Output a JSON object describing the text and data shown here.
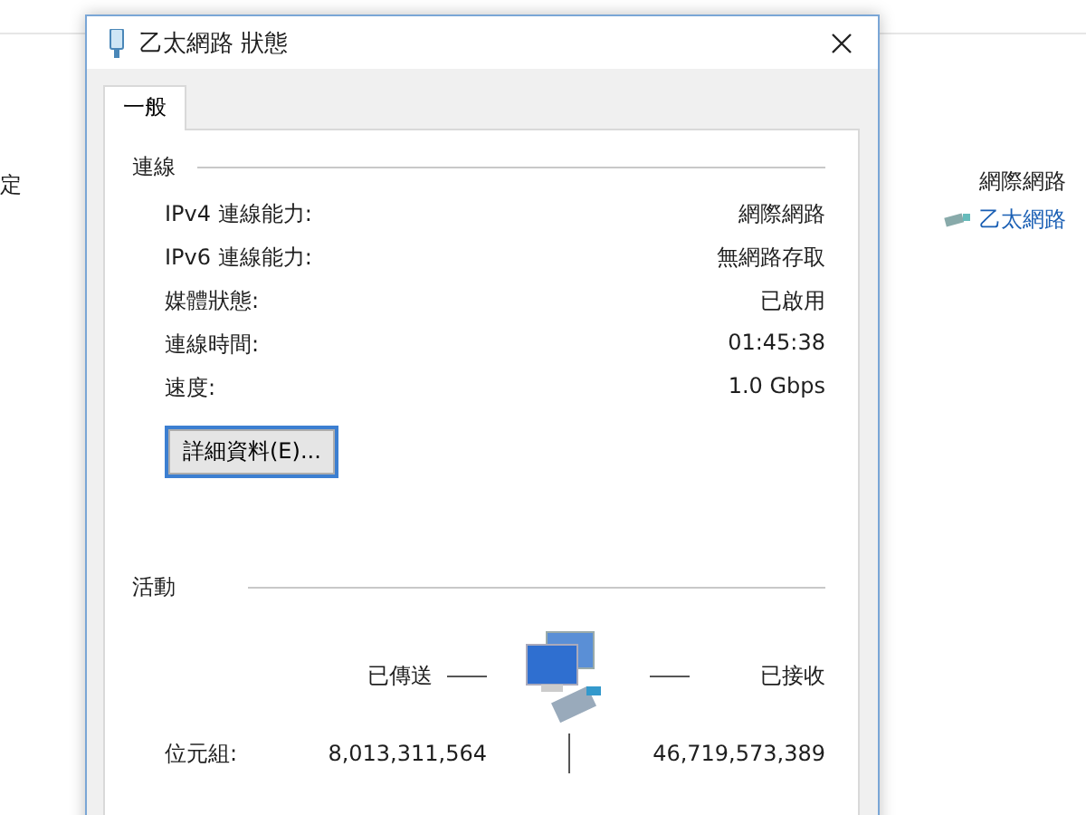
{
  "background": {
    "side_text": "定",
    "network_name": "網際網路",
    "adapter_link": "乙太網路"
  },
  "window": {
    "title": "乙太網路 狀態"
  },
  "tabs": [
    {
      "label": "一般",
      "selected": true
    }
  ],
  "connection": {
    "heading": "連線",
    "rows": [
      {
        "label": "IPv4 連線能力:",
        "value": "網際網路"
      },
      {
        "label": "IPv6 連線能力:",
        "value": "無網路存取"
      },
      {
        "label": "媒體狀態:",
        "value": "已啟用"
      },
      {
        "label": "連線時間:",
        "value": "01:45:38"
      },
      {
        "label": "速度:",
        "value": "1.0 Gbps"
      }
    ]
  },
  "details_button": "詳細資料(E)...",
  "activity": {
    "heading": "活動",
    "sent_label": "已傳送",
    "received_label": "已接收",
    "rows": [
      {
        "label": "位元組:",
        "sent": "8,013,311,564",
        "received": "46,719,573,389"
      }
    ]
  }
}
